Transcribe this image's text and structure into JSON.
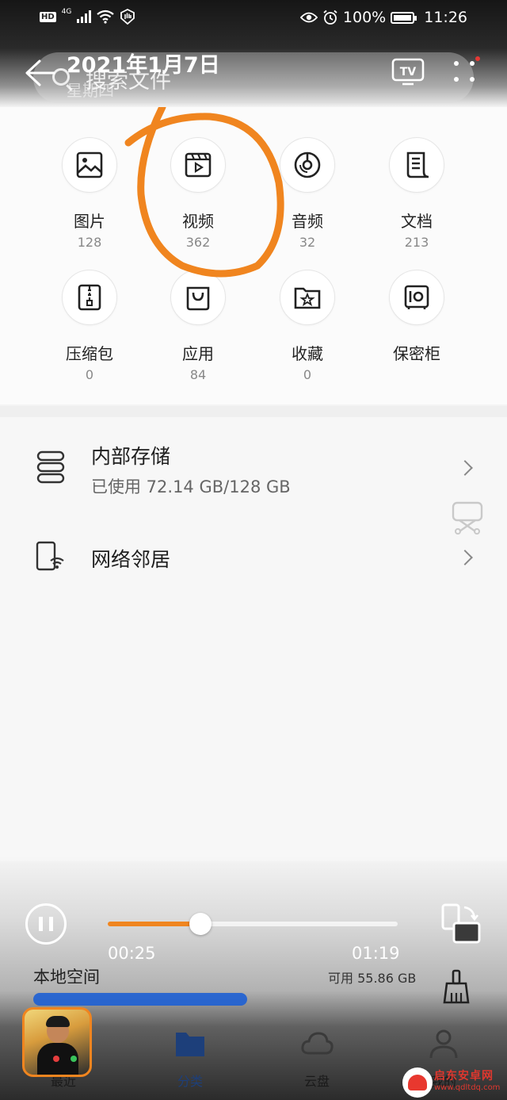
{
  "status_bar": {
    "hd": "HD",
    "network": "4G",
    "battery_percent": "100%",
    "time": "11:26"
  },
  "header": {
    "search_placeholder": "搜索文件",
    "date_title": "2021年1月7日",
    "date_weekday": "星期四",
    "tv_label": "TV"
  },
  "categories": [
    {
      "label": "图片",
      "count": "128",
      "icon": "image-icon"
    },
    {
      "label": "视频",
      "count": "362",
      "icon": "video-icon"
    },
    {
      "label": "音频",
      "count": "32",
      "icon": "audio-icon"
    },
    {
      "label": "文档",
      "count": "213",
      "icon": "document-icon"
    },
    {
      "label": "压缩包",
      "count": "0",
      "icon": "archive-icon"
    },
    {
      "label": "应用",
      "count": "84",
      "icon": "app-bag-icon"
    },
    {
      "label": "收藏",
      "count": "0",
      "icon": "favorite-folder-icon"
    },
    {
      "label": "保密柜",
      "count": "",
      "icon": "safe-icon"
    }
  ],
  "storage": {
    "internal_title": "内部存储",
    "internal_usage": "已使用 72.14 GB/128 GB",
    "network_title": "网络邻居"
  },
  "player": {
    "current_time": "00:25",
    "total_time": "01:19",
    "progress": 0.32,
    "accent_color": "#f0851f"
  },
  "local_space": {
    "label": "本地空间",
    "available": "可用 55.86 GB",
    "used_fraction": 0.56
  },
  "tabs": [
    {
      "label": "最近",
      "icon": "clock-icon"
    },
    {
      "label": "分类",
      "icon": "folder-icon"
    },
    {
      "label": "云盘",
      "icon": "cloud-icon"
    },
    {
      "label": "我的",
      "icon": "person-icon"
    }
  ],
  "watermark": {
    "title": "启东安卓网",
    "url": "www.qdltdq.com"
  }
}
